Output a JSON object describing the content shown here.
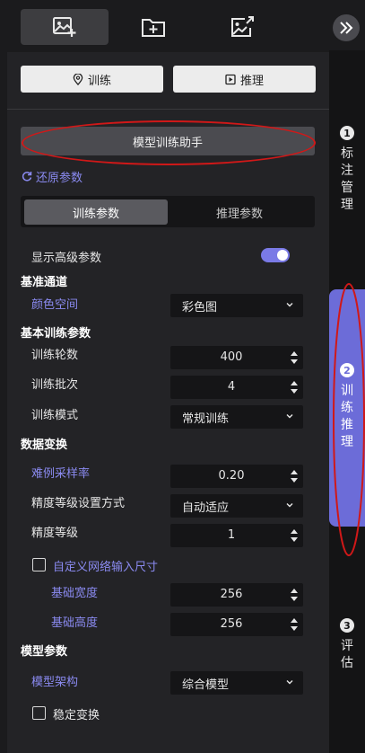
{
  "top_tabs": [
    {
      "icon": "image-add-icon"
    },
    {
      "icon": "folder-add-icon"
    },
    {
      "icon": "image-export-icon"
    }
  ],
  "collapse": {
    "icon": "double-chevron-right-icon"
  },
  "stepper": [
    {
      "num": "1",
      "label": "标注管理"
    },
    {
      "num": "2",
      "label": "训练推理"
    },
    {
      "num": "3",
      "label": "评估"
    }
  ],
  "mode_buttons": {
    "train": "训练",
    "infer": "推理"
  },
  "assistant_button": "模型训练助手",
  "reset_link": "还原参数",
  "param_tabs": {
    "train": "训练参数",
    "infer": "推理参数"
  },
  "show_advanced": {
    "label": "显示高级参数",
    "enabled": true
  },
  "sections": {
    "base_channel": "基准通道",
    "basic_train": "基本训练参数",
    "data_transform": "数据变换",
    "model_params": "模型参数"
  },
  "fields": {
    "color_space": {
      "label": "颜色空间",
      "value": "彩色图"
    },
    "epochs": {
      "label": "训练轮数",
      "value": "400"
    },
    "batch": {
      "label": "训练批次",
      "value": "4"
    },
    "train_mode": {
      "label": "训练模式",
      "value": "常规训练"
    },
    "hard_sample_rate": {
      "label": "难例采样率",
      "value": "0.20"
    },
    "precision_mode": {
      "label": "精度等级设置方式",
      "value": "自动适应"
    },
    "precision_level": {
      "label": "精度等级",
      "value": "1"
    },
    "custom_input_size": {
      "label": "自定义网络输入尺寸",
      "checked": false
    },
    "base_width": {
      "label": "基础宽度",
      "value": "256"
    },
    "base_height": {
      "label": "基础高度",
      "value": "256"
    },
    "model_arch": {
      "label": "模型架构",
      "value": "综合模型"
    },
    "stable_transform": {
      "label": "稳定变换",
      "checked": false
    }
  },
  "colors": {
    "accent": "#6c6cd8",
    "link": "#8a8af0",
    "highlight_ring": "#d01818"
  }
}
